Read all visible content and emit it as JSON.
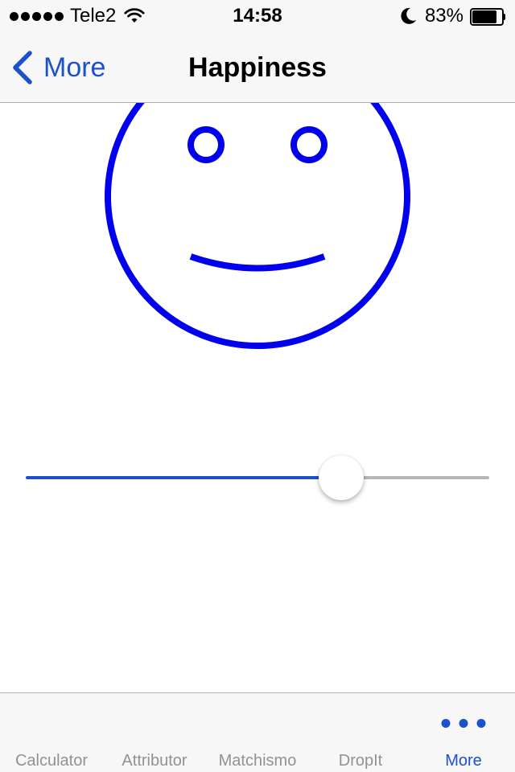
{
  "status_bar": {
    "carrier": "Tele2",
    "time": "14:58",
    "battery_text": "83%",
    "battery_level": 0.83,
    "icons": [
      "signal-dots-icon",
      "wifi-icon",
      "moon-icon",
      "battery-icon"
    ]
  },
  "nav": {
    "back_label": "More",
    "title": "Happiness"
  },
  "face": {
    "stroke_color": "#0000ee"
  },
  "slider": {
    "value": 0.7,
    "min_track_color": "#1c51cc",
    "max_track_color": "#b7b7b7"
  },
  "tab_bar": {
    "tabs": [
      {
        "label": "Calculator",
        "active": false
      },
      {
        "label": "Attributor",
        "active": false
      },
      {
        "label": "Matchismo",
        "active": false
      },
      {
        "label": "DropIt",
        "active": false
      },
      {
        "label": "More",
        "active": true,
        "icon": "more-dots-icon"
      }
    ]
  },
  "colors": {
    "accent": "#1c51cc",
    "inactive": "#929292"
  }
}
